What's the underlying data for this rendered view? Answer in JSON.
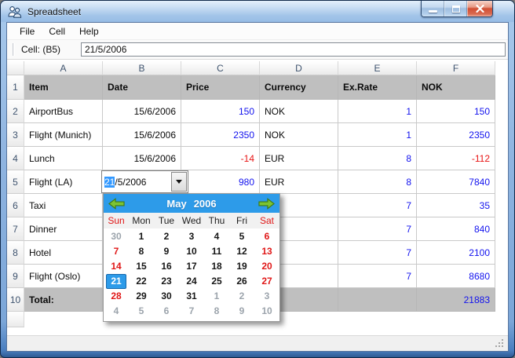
{
  "window": {
    "title": "Spreadsheet"
  },
  "menu": {
    "items": [
      "File",
      "Cell",
      "Help"
    ]
  },
  "toolbar": {
    "cell_label": "Cell: (B5)",
    "cell_value": "21/5/2006"
  },
  "grid": {
    "column_headers": [
      "A",
      "B",
      "C",
      "D",
      "E",
      "F"
    ],
    "rows": [
      {
        "header": "1",
        "band": true,
        "cells": [
          {
            "t": "Item",
            "a": "l",
            "b": true
          },
          {
            "t": "Date",
            "a": "l",
            "b": true
          },
          {
            "t": "Price",
            "a": "l",
            "b": true
          },
          {
            "t": "Currency",
            "a": "l",
            "b": true
          },
          {
            "t": "Ex.Rate",
            "a": "l",
            "b": true
          },
          {
            "t": "NOK",
            "a": "l",
            "b": true
          }
        ]
      },
      {
        "header": "2",
        "cells": [
          {
            "t": "AirportBus",
            "a": "l"
          },
          {
            "t": "15/6/2006",
            "a": "r"
          },
          {
            "t": "150",
            "a": "r",
            "c": "blue"
          },
          {
            "t": "NOK",
            "a": "l"
          },
          {
            "t": "1",
            "a": "r",
            "c": "blue"
          },
          {
            "t": "150",
            "a": "r",
            "c": "blue"
          }
        ]
      },
      {
        "header": "3",
        "cells": [
          {
            "t": "Flight (Munich)",
            "a": "l"
          },
          {
            "t": "15/6/2006",
            "a": "r"
          },
          {
            "t": "2350",
            "a": "r",
            "c": "blue"
          },
          {
            "t": "NOK",
            "a": "l"
          },
          {
            "t": "1",
            "a": "r",
            "c": "blue"
          },
          {
            "t": "2350",
            "a": "r",
            "c": "blue"
          }
        ]
      },
      {
        "header": "4",
        "cells": [
          {
            "t": "Lunch",
            "a": "l"
          },
          {
            "t": "15/6/2006",
            "a": "r"
          },
          {
            "t": "-14",
            "a": "r",
            "c": "red"
          },
          {
            "t": "EUR",
            "a": "l"
          },
          {
            "t": "8",
            "a": "r",
            "c": "blue"
          },
          {
            "t": "-112",
            "a": "r",
            "c": "red"
          }
        ]
      },
      {
        "header": "5",
        "cells": [
          {
            "t": "Flight (LA)",
            "a": "l"
          },
          {
            "t": "",
            "a": "l"
          },
          {
            "t": "980",
            "a": "r",
            "c": "blue"
          },
          {
            "t": "EUR",
            "a": "l"
          },
          {
            "t": "8",
            "a": "r",
            "c": "blue"
          },
          {
            "t": "7840",
            "a": "r",
            "c": "blue"
          }
        ]
      },
      {
        "header": "6",
        "cells": [
          {
            "t": "Taxi",
            "a": "l"
          },
          {
            "t": ""
          },
          {
            "t": ""
          },
          {
            "t": ""
          },
          {
            "t": "7",
            "a": "r",
            "c": "blue"
          },
          {
            "t": "35",
            "a": "r",
            "c": "blue"
          }
        ]
      },
      {
        "header": "7",
        "cells": [
          {
            "t": "Dinner",
            "a": "l"
          },
          {
            "t": ""
          },
          {
            "t": ""
          },
          {
            "t": ""
          },
          {
            "t": "7",
            "a": "r",
            "c": "blue"
          },
          {
            "t": "840",
            "a": "r",
            "c": "blue"
          }
        ]
      },
      {
        "header": "8",
        "cells": [
          {
            "t": "Hotel",
            "a": "l"
          },
          {
            "t": ""
          },
          {
            "t": ""
          },
          {
            "t": ""
          },
          {
            "t": "7",
            "a": "r",
            "c": "blue"
          },
          {
            "t": "2100",
            "a": "r",
            "c": "blue"
          }
        ]
      },
      {
        "header": "9",
        "cells": [
          {
            "t": "Flight (Oslo)",
            "a": "l"
          },
          {
            "t": ""
          },
          {
            "t": ""
          },
          {
            "t": ""
          },
          {
            "t": "7",
            "a": "r",
            "c": "blue"
          },
          {
            "t": "8680",
            "a": "r",
            "c": "blue"
          }
        ]
      },
      {
        "header": "10",
        "band": true,
        "cells": [
          {
            "t": "Total:",
            "a": "l",
            "b": true
          },
          {
            "t": ""
          },
          {
            "t": ""
          },
          {
            "t": ""
          },
          {
            "t": ""
          },
          {
            "t": "21883",
            "a": "r",
            "c": "blue"
          }
        ]
      }
    ]
  },
  "cell_editor": {
    "cell": "B5",
    "selected_text": "21",
    "rest_text": "/5/2006"
  },
  "calendar": {
    "month": "May",
    "year": "2006",
    "day_names": [
      {
        "t": "Sun",
        "s": "we"
      },
      {
        "t": "Mon"
      },
      {
        "t": "Tue"
      },
      {
        "t": "Wed"
      },
      {
        "t": "Thu"
      },
      {
        "t": "Fri"
      },
      {
        "t": "Sat",
        "s": "we"
      }
    ],
    "weeks": [
      [
        {
          "d": "30",
          "s": "out"
        },
        {
          "d": "1"
        },
        {
          "d": "2"
        },
        {
          "d": "3"
        },
        {
          "d": "4"
        },
        {
          "d": "5"
        },
        {
          "d": "6",
          "s": "we"
        }
      ],
      [
        {
          "d": "7",
          "s": "we"
        },
        {
          "d": "8"
        },
        {
          "d": "9"
        },
        {
          "d": "10"
        },
        {
          "d": "11"
        },
        {
          "d": "12"
        },
        {
          "d": "13",
          "s": "we"
        }
      ],
      [
        {
          "d": "14",
          "s": "we"
        },
        {
          "d": "15"
        },
        {
          "d": "16"
        },
        {
          "d": "17"
        },
        {
          "d": "18"
        },
        {
          "d": "19"
        },
        {
          "d": "20",
          "s": "we"
        }
      ],
      [
        {
          "d": "21",
          "s": "sel"
        },
        {
          "d": "22"
        },
        {
          "d": "23"
        },
        {
          "d": "24"
        },
        {
          "d": "25"
        },
        {
          "d": "26"
        },
        {
          "d": "27",
          "s": "we"
        }
      ],
      [
        {
          "d": "28",
          "s": "we"
        },
        {
          "d": "29"
        },
        {
          "d": "30"
        },
        {
          "d": "31"
        },
        {
          "d": "1",
          "s": "out"
        },
        {
          "d": "2",
          "s": "out"
        },
        {
          "d": "3",
          "s": "out"
        }
      ],
      [
        {
          "d": "4",
          "s": "out"
        },
        {
          "d": "5",
          "s": "out"
        },
        {
          "d": "6",
          "s": "out"
        },
        {
          "d": "7",
          "s": "out"
        },
        {
          "d": "8",
          "s": "out"
        },
        {
          "d": "9",
          "s": "out"
        },
        {
          "d": "10",
          "s": "out"
        }
      ]
    ]
  },
  "icons": {
    "app": "users-icon",
    "minimize": "minimize-icon",
    "maximize": "maximize-icon",
    "close": "close-icon",
    "dropdown": "chevron-down-icon",
    "calendar_prev": "arrow-left-icon",
    "calendar_next": "arrow-right-icon",
    "resize": "resize-grip-icon"
  },
  "colors": {
    "value_blue": "#1212EE",
    "negative_red": "#E81414",
    "band_gray": "#BFBFBF",
    "calendar_header_blue": "#2D9BE9",
    "selection_blue": "#3399FF",
    "arrow_green": "#7CC433",
    "weekend_red": "#E01818",
    "outside_month_gray": "#9CA4AC"
  }
}
